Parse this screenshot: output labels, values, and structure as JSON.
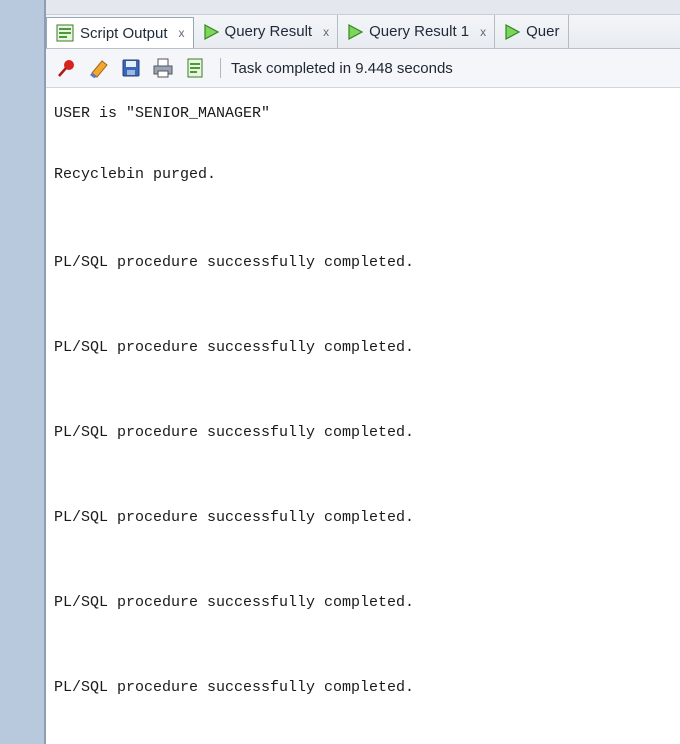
{
  "tabs": [
    {
      "label": "Script Output",
      "close": "x",
      "icon": "script-output-icon",
      "active": true
    },
    {
      "label": "Query Result",
      "close": "x",
      "icon": "play-icon",
      "active": false
    },
    {
      "label": "Query Result 1",
      "close": "x",
      "icon": "play-icon",
      "active": false
    },
    {
      "label": "Quer",
      "close": "",
      "icon": "play-icon",
      "active": false
    }
  ],
  "toolbar": {
    "buttons": [
      "pin-icon",
      "eraser-icon",
      "save-icon",
      "print-icon",
      "open-file-icon"
    ],
    "status": "Task completed in 9.448 seconds"
  },
  "output": {
    "lines": [
      "USER is \"SENIOR_MANAGER\"",
      "Recyclebin purged.",
      "PL/SQL procedure successfully completed.",
      "PL/SQL procedure successfully completed.",
      "PL/SQL procedure successfully completed.",
      "PL/SQL procedure successfully completed.",
      "PL/SQL procedure successfully completed.",
      "PL/SQL procedure successfully completed."
    ]
  },
  "colors": {
    "gutter": "#b8c9dd",
    "tab_active_bg": "#ffffff",
    "play_green": "#3fae2a"
  }
}
